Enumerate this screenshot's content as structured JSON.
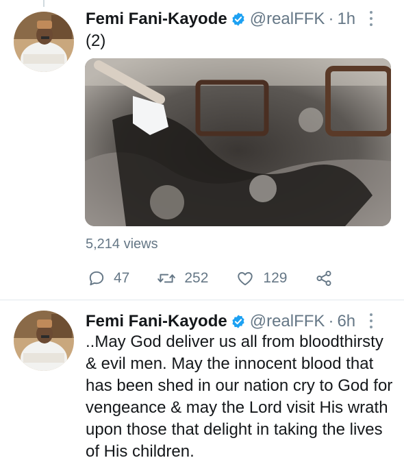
{
  "tweets": [
    {
      "display_name": "Femi Fani-Kayode",
      "handle": "@realFFK",
      "separator": "·",
      "time": "1h",
      "text": "(2)",
      "views": "5,214 views",
      "replies": "47",
      "retweets": "252",
      "likes": "129"
    },
    {
      "display_name": "Femi Fani-Kayode",
      "handle": "@realFFK",
      "separator": "·",
      "time": "6h",
      "text": "..May God deliver us all from bloodthirsty & evil men. May the innocent blood that has been shed in our nation cry to God for vengeance & may the Lord visit His wrath upon those that delight in taking the lives of His children."
    }
  ],
  "colors": {
    "verified": "#1da1f2",
    "secondary_text": "#657786",
    "divider": "#e1e8ed"
  },
  "icons": [
    "verified-badge-icon",
    "more-options-icon",
    "reply-icon",
    "retweet-icon",
    "like-icon",
    "share-icon"
  ]
}
